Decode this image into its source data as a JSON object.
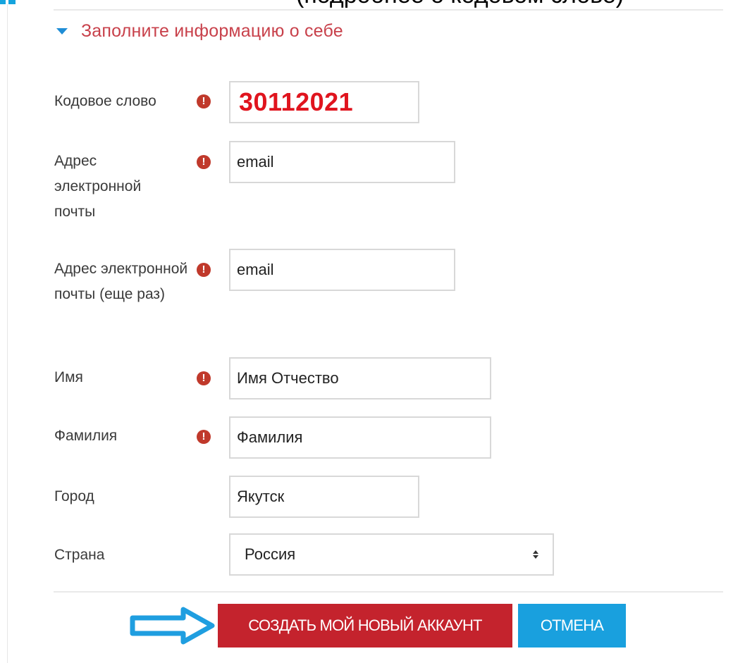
{
  "header": {
    "clipped_text": "(подробнее о кодовом слове)"
  },
  "section": {
    "title": "Заполните информацию о себе"
  },
  "form": {
    "codeword": {
      "label": "Кодовое слово",
      "value": "30112021"
    },
    "email": {
      "label": "Адрес электронной почты",
      "value": "email"
    },
    "email_repeat": {
      "label": "Адрес электронной почты (еще раз)",
      "value": "email"
    },
    "firstname": {
      "label": "Имя",
      "value": "Имя Отчество"
    },
    "lastname": {
      "label": "Фамилия",
      "value": "Фамилия"
    },
    "city": {
      "label": "Город",
      "value": "Якутск"
    },
    "country": {
      "label": "Страна",
      "value": "Россия"
    },
    "required_mark": "!"
  },
  "buttons": {
    "create": "СОЗДАТЬ МОЙ НОВЫЙ АККАУНТ",
    "cancel": "ОТМЕНА"
  },
  "colors": {
    "section_title": "#c8414b",
    "required_icon": "#c0392b",
    "codeword_text": "#e0141e",
    "create_button": "#c4232d",
    "cancel_button": "#19a0de",
    "arrow": "#1f9ee0"
  },
  "icons": {
    "section_toggle": "caret-down-icon",
    "required": "exclamation-circle-icon",
    "select": "select-arrows-icon",
    "pointer": "arrow-right-outline-icon"
  }
}
